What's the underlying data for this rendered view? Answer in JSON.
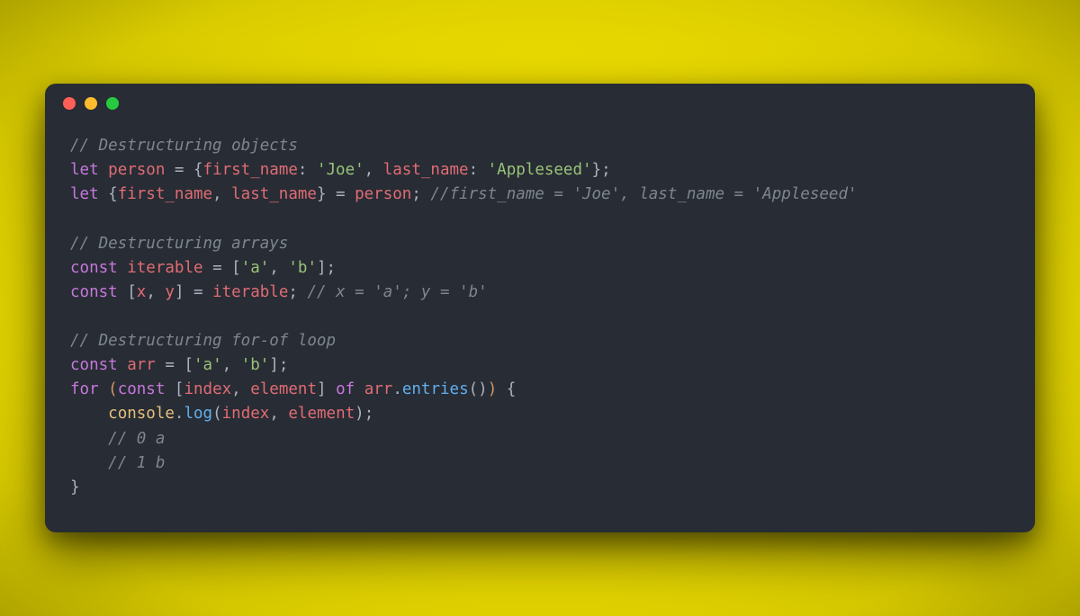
{
  "traffic_lights": [
    "red",
    "yellow",
    "green"
  ],
  "colors": {
    "bg_window": "#282c34",
    "bg_page": "#f3ec00",
    "comment": "#7e8690",
    "keyword": "#c678dd",
    "identifier": "#e06c75",
    "string": "#98c379",
    "punctuation": "#abb2bf",
    "bracket_highlight": "#d19a66",
    "function": "#61afef",
    "object": "#e5c07b"
  },
  "code_lines": [
    [
      {
        "c": "cm",
        "t": "// Destructuring objects"
      }
    ],
    [
      {
        "c": "kw",
        "t": "let"
      },
      {
        "c": "pn",
        "t": " "
      },
      {
        "c": "id",
        "t": "person"
      },
      {
        "c": "pn",
        "t": " = {"
      },
      {
        "c": "prop",
        "t": "first_name"
      },
      {
        "c": "pn",
        "t": ": "
      },
      {
        "c": "str",
        "t": "'Joe'"
      },
      {
        "c": "pn",
        "t": ", "
      },
      {
        "c": "prop",
        "t": "last_name"
      },
      {
        "c": "pn",
        "t": ": "
      },
      {
        "c": "str",
        "t": "'Appleseed'"
      },
      {
        "c": "pn",
        "t": "};"
      }
    ],
    [
      {
        "c": "kw",
        "t": "let"
      },
      {
        "c": "pn",
        "t": " {"
      },
      {
        "c": "id",
        "t": "first_name"
      },
      {
        "c": "pn",
        "t": ", "
      },
      {
        "c": "id",
        "t": "last_name"
      },
      {
        "c": "pn",
        "t": "} = "
      },
      {
        "c": "id",
        "t": "person"
      },
      {
        "c": "pn",
        "t": "; "
      },
      {
        "c": "cm",
        "t": "//first_name = 'Joe', last_name = 'Appleseed'"
      }
    ],
    [
      {
        "c": "pn",
        "t": ""
      }
    ],
    [
      {
        "c": "cm",
        "t": "// Destructuring arrays"
      }
    ],
    [
      {
        "c": "kw",
        "t": "const"
      },
      {
        "c": "pn",
        "t": " "
      },
      {
        "c": "id",
        "t": "iterable"
      },
      {
        "c": "pn",
        "t": " = ["
      },
      {
        "c": "str",
        "t": "'a'"
      },
      {
        "c": "pn",
        "t": ", "
      },
      {
        "c": "str",
        "t": "'b'"
      },
      {
        "c": "pn",
        "t": "];"
      }
    ],
    [
      {
        "c": "kw",
        "t": "const"
      },
      {
        "c": "pn",
        "t": " ["
      },
      {
        "c": "id",
        "t": "x"
      },
      {
        "c": "pn",
        "t": ", "
      },
      {
        "c": "id",
        "t": "y"
      },
      {
        "c": "pn",
        "t": "] = "
      },
      {
        "c": "id",
        "t": "iterable"
      },
      {
        "c": "pn",
        "t": "; "
      },
      {
        "c": "cm",
        "t": "// x = 'a'; y = 'b'"
      }
    ],
    [
      {
        "c": "pn",
        "t": ""
      }
    ],
    [
      {
        "c": "cm",
        "t": "// Destructuring for-of loop"
      }
    ],
    [
      {
        "c": "kw",
        "t": "const"
      },
      {
        "c": "pn",
        "t": " "
      },
      {
        "c": "id",
        "t": "arr"
      },
      {
        "c": "pn",
        "t": " = ["
      },
      {
        "c": "str",
        "t": "'a'"
      },
      {
        "c": "pn",
        "t": ", "
      },
      {
        "c": "str",
        "t": "'b'"
      },
      {
        "c": "pn",
        "t": "];"
      }
    ],
    [
      {
        "c": "kw",
        "t": "for"
      },
      {
        "c": "pn",
        "t": " "
      },
      {
        "c": "br",
        "t": "("
      },
      {
        "c": "kw",
        "t": "const"
      },
      {
        "c": "pn",
        "t": " ["
      },
      {
        "c": "id",
        "t": "index"
      },
      {
        "c": "pn",
        "t": ", "
      },
      {
        "c": "id",
        "t": "element"
      },
      {
        "c": "pn",
        "t": "] "
      },
      {
        "c": "kw",
        "t": "of"
      },
      {
        "c": "pn",
        "t": " "
      },
      {
        "c": "id",
        "t": "arr"
      },
      {
        "c": "pn",
        "t": "."
      },
      {
        "c": "fn",
        "t": "entries"
      },
      {
        "c": "pn",
        "t": "()"
      },
      {
        "c": "br",
        "t": ")"
      },
      {
        "c": "pn",
        "t": " {"
      }
    ],
    [
      {
        "c": "pn",
        "t": "    "
      },
      {
        "c": "obj",
        "t": "console"
      },
      {
        "c": "pn",
        "t": "."
      },
      {
        "c": "fn",
        "t": "log"
      },
      {
        "c": "pn",
        "t": "("
      },
      {
        "c": "id",
        "t": "index"
      },
      {
        "c": "pn",
        "t": ", "
      },
      {
        "c": "id",
        "t": "element"
      },
      {
        "c": "pn",
        "t": ");"
      }
    ],
    [
      {
        "c": "pn",
        "t": "    "
      },
      {
        "c": "cm",
        "t": "// 0 a"
      }
    ],
    [
      {
        "c": "pn",
        "t": "    "
      },
      {
        "c": "cm",
        "t": "// 1 b"
      }
    ],
    [
      {
        "c": "pn",
        "t": "}"
      }
    ]
  ]
}
